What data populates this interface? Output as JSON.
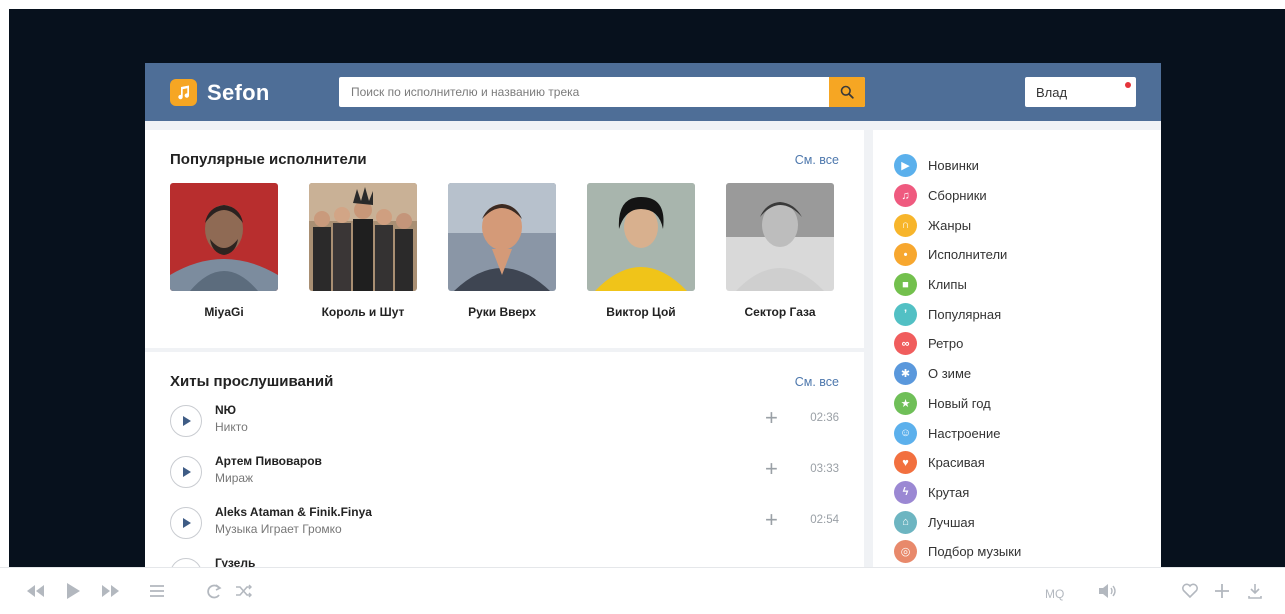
{
  "header": {
    "logo_text": "Sefon",
    "search_placeholder": "Поиск по исполнителю и названию трека",
    "user_name": "Влад"
  },
  "popular_artists": {
    "title": "Популярные исполнители",
    "see_all": "См. все",
    "items": [
      {
        "name": "MiyaGi"
      },
      {
        "name": "Король и Шут"
      },
      {
        "name": "Руки Вверх"
      },
      {
        "name": "Виктор Цой"
      },
      {
        "name": "Сектор Газа"
      }
    ]
  },
  "hits": {
    "title": "Хиты прослушиваний",
    "see_all": "См. все",
    "tracks": [
      {
        "artist": "NЮ",
        "title": "Никто",
        "duration": "02:36"
      },
      {
        "artist": "Артем Пивоваров",
        "title": "Мираж",
        "duration": "03:33"
      },
      {
        "artist": "Aleks Ataman & Finik.Finya",
        "title": "Музыка Играет Громко",
        "duration": "02:54"
      },
      {
        "artist": "Гузель",
        "title": "",
        "duration": ""
      }
    ]
  },
  "sidebar": {
    "items": [
      {
        "label": "Новинки",
        "icon": "play-icon",
        "color": "#5bb0ec"
      },
      {
        "label": "Сборники",
        "icon": "music-note-icon",
        "color": "#ef5a7f"
      },
      {
        "label": "Жанры",
        "icon": "headphones-icon",
        "color": "#f7b52b"
      },
      {
        "label": "Исполнители",
        "icon": "microphone-icon",
        "color": "#f7a72f"
      },
      {
        "label": "Клипы",
        "icon": "video-icon",
        "color": "#73c04d"
      },
      {
        "label": "Популярная",
        "icon": "volume-icon",
        "color": "#52c0c4"
      },
      {
        "label": "Ретро",
        "icon": "cassette-icon",
        "color": "#f05d5d"
      },
      {
        "label": "О зиме",
        "icon": "snowflake-icon",
        "color": "#5a98dc"
      },
      {
        "label": "Новый год",
        "icon": "star-icon",
        "color": "#6fbf58"
      },
      {
        "label": "Настроение",
        "icon": "smile-icon",
        "color": "#5cb0ec"
      },
      {
        "label": "Красивая",
        "icon": "heart-icon",
        "color": "#f2703f"
      },
      {
        "label": "Крутая",
        "icon": "lightning-icon",
        "color": "#9b88d3"
      },
      {
        "label": "Лучшая",
        "icon": "trophy-icon",
        "color": "#6db5c1"
      },
      {
        "label": "Подбор музыки",
        "icon": "record-icon",
        "color": "#e8896b"
      }
    ]
  },
  "player": {
    "quality": "MQ"
  },
  "colors": {
    "header_bg": "#4e6e97",
    "accent": "#f6a623",
    "link": "#4e78ad",
    "backdrop": "#07111d"
  }
}
